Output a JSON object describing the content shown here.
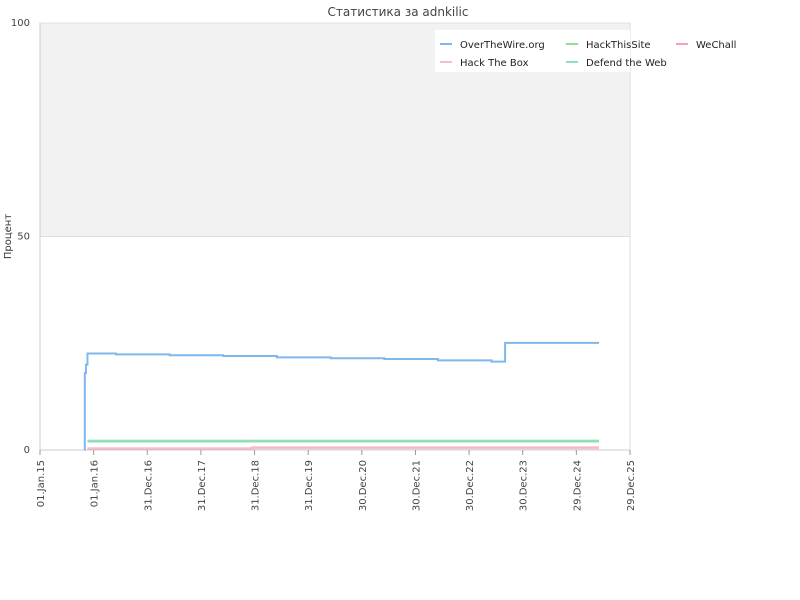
{
  "chart_data": {
    "type": "line",
    "title": "Статистика за adnkilic",
    "ylabel": "Процент",
    "xlabel": "",
    "ylim": [
      0,
      100
    ],
    "yticks": [
      "0",
      "50",
      "100"
    ],
    "xlim": [
      "2015-01-01",
      "2025-12-29"
    ],
    "xticks": [
      {
        "date": "2015-01-01",
        "label": "01.Jan.15"
      },
      {
        "date": "2016-01-01",
        "label": "01.Jan.16"
      },
      {
        "date": "2016-12-31",
        "label": "31.Dec.16"
      },
      {
        "date": "2017-12-31",
        "label": "31.Dec.17"
      },
      {
        "date": "2018-12-31",
        "label": "31.Dec.18"
      },
      {
        "date": "2019-12-31",
        "label": "31.Dec.19"
      },
      {
        "date": "2020-12-30",
        "label": "30.Dec.20"
      },
      {
        "date": "2021-12-30",
        "label": "30.Dec.21"
      },
      {
        "date": "2022-12-30",
        "label": "30.Dec.22"
      },
      {
        "date": "2023-12-30",
        "label": "30.Dec.23"
      },
      {
        "date": "2024-12-29",
        "label": "29.Dec.24"
      },
      {
        "date": "2025-12-29",
        "label": "29.Dec.25"
      }
    ],
    "shaded_band": {
      "from": 50,
      "to": 100,
      "color": "#f2f2f2"
    },
    "grid": "horizontal",
    "legend_position": "top-right",
    "series": [
      {
        "name": "OverTheWire.org",
        "color": "#7fb8ec",
        "step": true,
        "points": [
          {
            "x": "2015-11-01",
            "y": 0
          },
          {
            "x": "2015-11-02",
            "y": 18
          },
          {
            "x": "2015-11-10",
            "y": 20
          },
          {
            "x": "2015-11-20",
            "y": 22.6
          },
          {
            "x": "2016-06-01",
            "y": 22.4
          },
          {
            "x": "2017-06-01",
            "y": 22.2
          },
          {
            "x": "2018-06-01",
            "y": 22.0
          },
          {
            "x": "2019-06-01",
            "y": 21.7
          },
          {
            "x": "2020-06-01",
            "y": 21.5
          },
          {
            "x": "2021-06-01",
            "y": 21.3
          },
          {
            "x": "2022-06-01",
            "y": 21.0
          },
          {
            "x": "2023-06-01",
            "y": 20.7
          },
          {
            "x": "2023-09-01",
            "y": 25.1
          },
          {
            "x": "2025-06-01",
            "y": 25.1
          }
        ]
      },
      {
        "name": "HackThisSite",
        "color": "#90e090",
        "step": true,
        "points": [
          {
            "x": "2015-11-20",
            "y": 2.0
          },
          {
            "x": "2025-06-01",
            "y": 2.0
          }
        ]
      },
      {
        "name": "WeChall",
        "color": "#f4a0c0",
        "step": true,
        "points": [
          {
            "x": "2015-11-20",
            "y": 0.3
          },
          {
            "x": "2018-12-15",
            "y": 0.6
          },
          {
            "x": "2025-06-01",
            "y": 0.6
          }
        ]
      },
      {
        "name": "Hack The Box",
        "color": "#f4c0c8",
        "step": true,
        "points": [
          {
            "x": "2015-11-20",
            "y": 0.4
          },
          {
            "x": "2025-06-01",
            "y": 0.4
          }
        ]
      },
      {
        "name": "Defend the Web",
        "color": "#90e0c0",
        "step": true,
        "points": [
          {
            "x": "2015-11-20",
            "y": 2.2
          },
          {
            "x": "2025-06-01",
            "y": 2.2
          }
        ]
      }
    ]
  }
}
